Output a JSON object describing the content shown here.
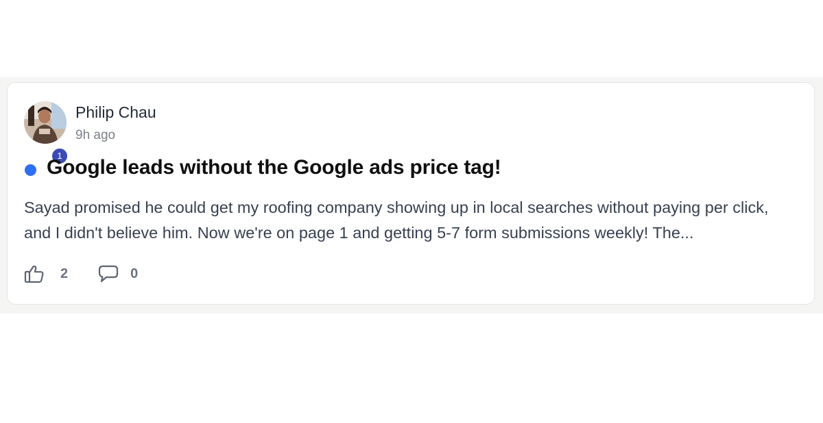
{
  "post": {
    "author_name": "Philip Chau",
    "timestamp": "9h ago",
    "author_level": "1",
    "title": "Google leads without the Google ads price tag!",
    "excerpt": "Sayad promised he could get my roofing company showing up in local searches without paying per click, and I didn't believe him. Now we're on page 1 and getting 5-7 form submissions weekly! The...",
    "unread": true,
    "likes": "2",
    "comments": "0"
  },
  "icons": {
    "like": "thumbs-up-icon",
    "comment": "speech-bubble-icon"
  },
  "colors": {
    "unread_dot": "#2f6ff3",
    "level_badge": "#3b4bb5",
    "card_background": "#ffffff",
    "page_band": "#f5f5f4"
  }
}
